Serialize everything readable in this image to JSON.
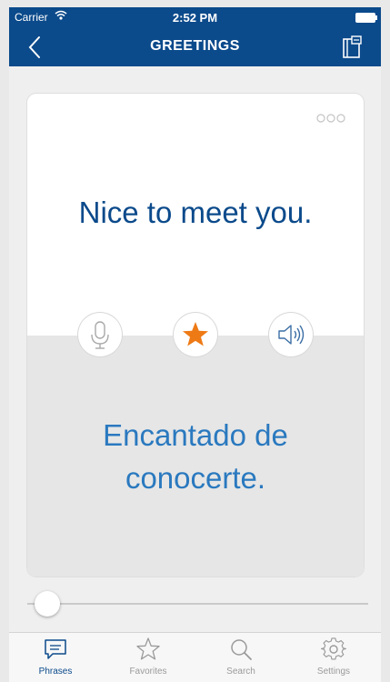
{
  "status_bar": {
    "carrier": "Carrier",
    "time": "2:52 PM"
  },
  "nav": {
    "title": "GREETINGS",
    "back_icon": "chevron-left-icon",
    "book_icon": "phrasebook-icon"
  },
  "card": {
    "phrase": "Nice to meet you.",
    "translation": "Encantado de conocerte.",
    "favorited": true
  },
  "slider": {
    "value": 0
  },
  "tabs": [
    {
      "label": "Phrases",
      "icon": "speech-bubble-icon",
      "active": true
    },
    {
      "label": "Favorites",
      "icon": "star-icon",
      "active": false
    },
    {
      "label": "Search",
      "icon": "search-icon",
      "active": false
    },
    {
      "label": "Settings",
      "icon": "gear-icon",
      "active": false
    }
  ],
  "colors": {
    "nav_bg": "#0b4a8b",
    "phrase_text": "#0b4a8b",
    "translation_text": "#2a79bf",
    "star_accent": "#ee7a16",
    "tab_active": "#0b4a8b"
  }
}
